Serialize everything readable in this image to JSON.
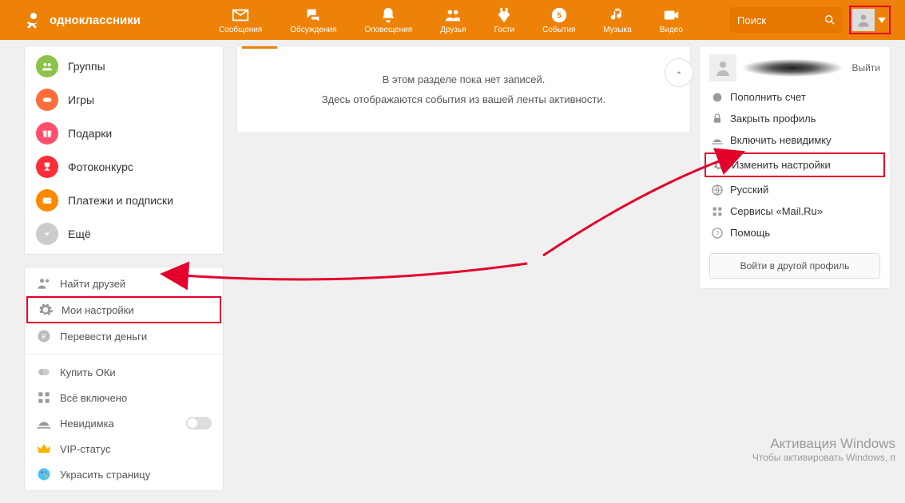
{
  "brand": "одноклассники",
  "topnav": {
    "messages": "Сообщения",
    "discussions": "Обсуждения",
    "notifications": "Оповещения",
    "friends": "Друзья",
    "guests": "Гости",
    "events": "События",
    "music": "Музыка",
    "video": "Видео"
  },
  "search": {
    "placeholder": "Поиск"
  },
  "sidebar1": {
    "groups": "Группы",
    "games": "Игры",
    "gifts": "Подарки",
    "photo_contest": "Фотоконкурс",
    "payments": "Платежи и подписки",
    "more": "Ещё"
  },
  "sidebar2": {
    "find_friends": "Найти друзей",
    "my_settings": "Мои настройки",
    "send_money": "Перевести деньги",
    "buy_ok": "Купить ОКи",
    "all_inclusive": "Всё включено",
    "invisible": "Невидимка",
    "vip": "VIP-статус",
    "decorate": "Украсить страницу"
  },
  "feed": {
    "empty_title": "В этом разделе пока нет записей.",
    "empty_sub": "Здесь отображаются события из вашей ленты активности."
  },
  "dropdown": {
    "logout": "Выйти",
    "topup": "Пополнить счет",
    "close_profile": "Закрыть профиль",
    "enable_invisible": "Включить невидимку",
    "change_settings": "Изменить настройки",
    "language": "Русский",
    "mailru": "Сервисы «Mail.Ru»",
    "help": "Помощь",
    "login_other": "Войти в другой профиль"
  },
  "watermark": {
    "title": "Активация Windows",
    "sub": "Чтобы активировать Windows, п"
  }
}
